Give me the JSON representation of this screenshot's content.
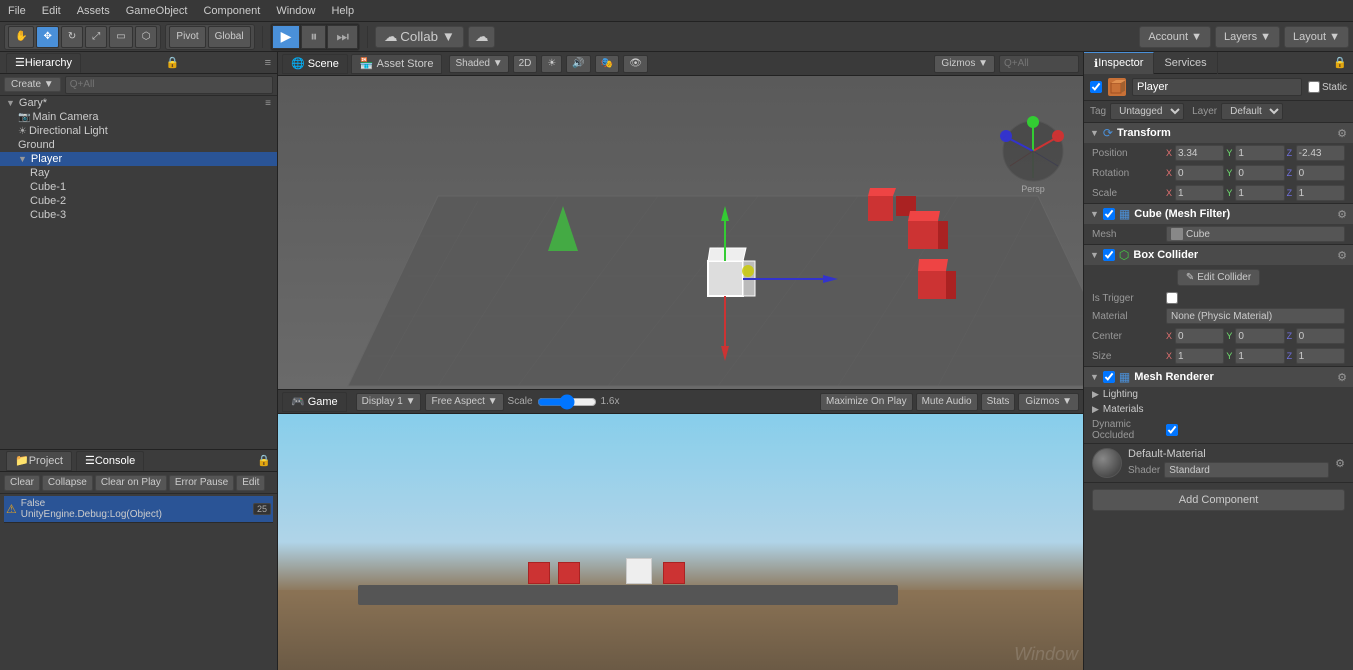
{
  "menubar": {
    "items": [
      "File",
      "Edit",
      "Assets",
      "GameObject",
      "Component",
      "Window",
      "Help"
    ]
  },
  "toolbar": {
    "pivot_label": "Pivot",
    "global_label": "Global",
    "collab_label": "Collab ▼",
    "account_label": "Account ▼",
    "layers_label": "Layers ▼",
    "layout_label": "Layout ▼"
  },
  "hierarchy": {
    "title": "Hierarchy",
    "create_label": "Create ▼",
    "search_placeholder": "Q+All",
    "items": [
      {
        "label": "Gary*",
        "depth": 0,
        "expanded": true,
        "is_root": true
      },
      {
        "label": "Main Camera",
        "depth": 1
      },
      {
        "label": "Directional Light",
        "depth": 1
      },
      {
        "label": "Ground",
        "depth": 1
      },
      {
        "label": "Player",
        "depth": 1,
        "selected": true,
        "expanded": true
      },
      {
        "label": "Ray",
        "depth": 2
      },
      {
        "label": "Cube-1",
        "depth": 2
      },
      {
        "label": "Cube-2",
        "depth": 2
      },
      {
        "label": "Cube-3",
        "depth": 2
      }
    ]
  },
  "scene": {
    "title": "Scene",
    "tab_label": "Scene",
    "shading": "Shaded",
    "mode_2d": "2D",
    "gizmos_label": "Gizmos ▼",
    "search_placeholder": "Q+All"
  },
  "asset_store": {
    "tab_label": "Asset Store"
  },
  "game": {
    "title": "Game",
    "tab_label": "Game",
    "display": "Display 1",
    "aspect": "Free Aspect",
    "scale_label": "Scale",
    "scale_value": "1.6x",
    "maximize_label": "Maximize On Play",
    "mute_label": "Mute Audio",
    "stats_label": "Stats",
    "gizmos_label": "Gizmos ▼"
  },
  "console": {
    "title": "Console",
    "clear_label": "Clear",
    "collapse_label": "Collapse",
    "clear_on_play_label": "Clear on Play",
    "error_pause_label": "Error Pause",
    "edit_label": "Edit",
    "log_text": "False\nUnityEngine.Debug:Log(Object)",
    "log_count": "25"
  },
  "inspector": {
    "title": "Inspector",
    "services_label": "Services",
    "object_name": "Player",
    "static_label": "Static",
    "tag_label": "Tag",
    "tag_value": "Untagged",
    "layer_label": "Layer",
    "layer_value": "Default",
    "transform": {
      "title": "Transform",
      "position_label": "Position",
      "pos_x": "3.34",
      "pos_y": "1",
      "pos_z": "-2.43",
      "rotation_label": "Rotation",
      "rot_x": "0",
      "rot_y": "0",
      "rot_z": "0",
      "scale_label": "Scale",
      "scale_x": "1",
      "scale_y": "1",
      "scale_z": "1"
    },
    "mesh_filter": {
      "title": "Cube (Mesh Filter)",
      "mesh_label": "Mesh",
      "mesh_value": "Cube"
    },
    "box_collider": {
      "title": "Box Collider",
      "edit_collider_label": "Edit Collider",
      "is_trigger_label": "Is Trigger",
      "material_label": "Material",
      "material_value": "None (Physic Material)",
      "center_label": "Center",
      "cx": "0",
      "cy": "0",
      "cz": "0",
      "size_label": "Size",
      "sx": "1",
      "sy": "1",
      "sz": "1"
    },
    "mesh_renderer": {
      "title": "Mesh Renderer",
      "lighting_label": "Lighting",
      "materials_label": "Materials",
      "dynamic_occluded_label": "Dynamic Occluded"
    },
    "material": {
      "name": "Default-Material",
      "shader_label": "Shader",
      "shader_value": "Standard"
    },
    "add_component_label": "Add Component"
  }
}
